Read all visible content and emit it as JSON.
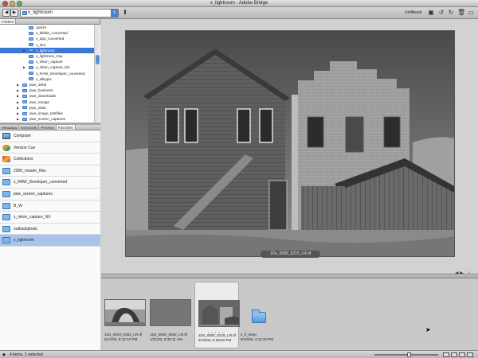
{
  "window": {
    "title": "x_lightroom - Adobe Bridge"
  },
  "toolbar": {
    "back": "◀",
    "forward": "▶",
    "path_value": "x_lightroom",
    "filter_label": "Unfiltered"
  },
  "upper_tabs": [
    {
      "label": "Folders",
      "active": true
    }
  ],
  "folders": [
    {
      "label": "upsize",
      "indent": 1,
      "expandable": false,
      "selected": false
    },
    {
      "label": "x_bibble_converted",
      "indent": 1,
      "expandable": false,
      "selected": false
    },
    {
      "label": "x_dpp_converted",
      "indent": 1,
      "expandable": false,
      "selected": false
    },
    {
      "label": "x_dxo",
      "indent": 1,
      "expandable": false,
      "selected": false
    },
    {
      "label": "x_lightroom",
      "indent": 1,
      "expandable": true,
      "selected": true
    },
    {
      "label": "x_lightzone_tmp",
      "indent": 1,
      "expandable": false,
      "selected": false
    },
    {
      "label": "x_nikon_capture",
      "indent": 1,
      "expandable": false,
      "selected": false
    },
    {
      "label": "x_nikon_capture_NX",
      "indent": 1,
      "expandable": true,
      "selected": false
    },
    {
      "label": "x_RAW_Developer_converted",
      "indent": 1,
      "expandable": false,
      "selected": false
    },
    {
      "label": "x_silkypix",
      "indent": 1,
      "expandable": false,
      "selected": false
    },
    {
      "label": "pwe_2005",
      "indent": 0,
      "expandable": true,
      "selected": false
    },
    {
      "label": "pwe_business",
      "indent": 0,
      "expandable": true,
      "selected": false
    },
    {
      "label": "pwe_downloads",
      "indent": 0,
      "expandable": true,
      "selected": false
    },
    {
      "label": "pwe_emags",
      "indent": 0,
      "expandable": true,
      "selected": false
    },
    {
      "label": "pwe_dvds",
      "indent": 0,
      "expandable": true,
      "selected": false
    },
    {
      "label": "pwe_image_testfiles",
      "indent": 0,
      "expandable": true,
      "selected": false
    },
    {
      "label": "pwe_screen_captures",
      "indent": 0,
      "expandable": true,
      "selected": false
    }
  ],
  "lower_tabs": [
    {
      "label": "Metadata",
      "active": false
    },
    {
      "label": "Keywords",
      "active": false
    },
    {
      "label": "Preview",
      "active": false
    },
    {
      "label": "Favorites",
      "active": true
    }
  ],
  "favorites": [
    {
      "label": "Computer",
      "icon": "computer",
      "selected": false
    },
    {
      "label": "Version Cue",
      "icon": "vcue",
      "selected": false
    },
    {
      "label": "Collections",
      "icon": "coll",
      "selected": false
    },
    {
      "label": "2006_master_files",
      "icon": "blue",
      "selected": false
    },
    {
      "label": "x_RAW_Developer_converted",
      "icon": "blue",
      "selected": false
    },
    {
      "label": "pwe_screen_captures",
      "icon": "blue",
      "selected": false
    },
    {
      "label": "B_W",
      "icon": "blue",
      "selected": false
    },
    {
      "label": "x_nikon_capture_NX",
      "icon": "blue",
      "selected": false
    },
    {
      "label": "outbackphoto",
      "icon": "blue",
      "selected": false
    },
    {
      "label": "x_lightroom",
      "icon": "blue",
      "selected": true
    }
  ],
  "preview": {
    "filename": "1Ds_0000_5215_LR.tif",
    "nav_arrows": "◀ ▶"
  },
  "thumbnails": [
    {
      "name": "1Ds_0003_0352_LR.tif",
      "date": "6/12/03, 8:42:10 PM",
      "kind": "arch",
      "selected": false
    },
    {
      "name": "1Ds_0000_0852_LR.tif",
      "date": "1/21/03, 8:39:11 AM",
      "kind": "sky",
      "selected": false
    },
    {
      "name": "1Ds_0000_5215_LR.tif",
      "date": "6/19/04, 5:38:53 PM",
      "kind": "house",
      "selected": true,
      "dots": "• • • • •"
    },
    {
      "name": "x_lr_keep",
      "date": "5/10/06, 4:11:10 PM",
      "kind": "folder",
      "selected": false
    }
  ],
  "status": {
    "text": "4 items, 1 selected",
    "thumb_size_fraction": 0.55
  }
}
